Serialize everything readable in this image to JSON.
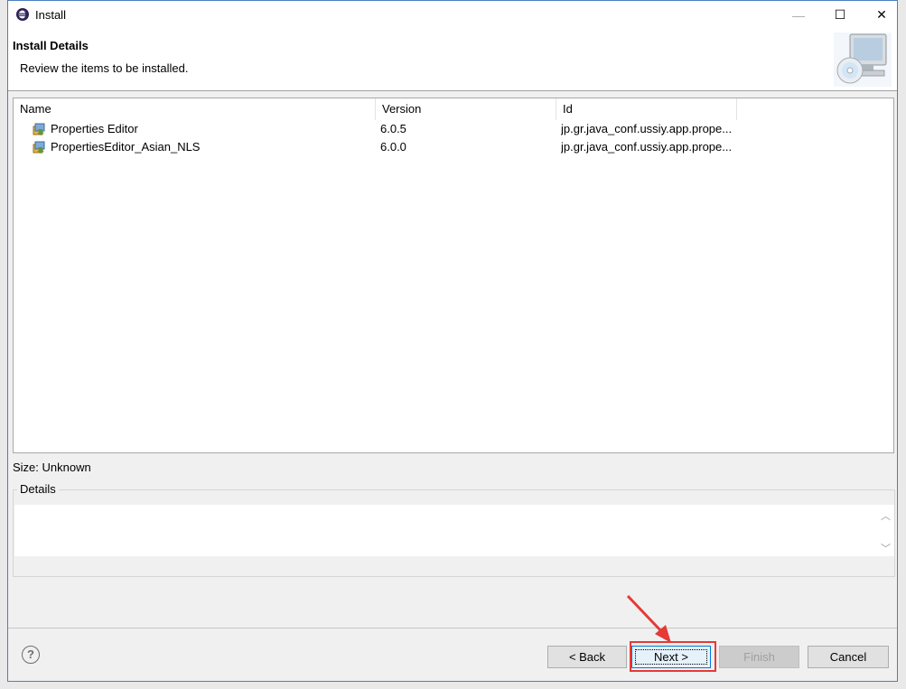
{
  "window": {
    "title": "Install",
    "minimize_glyph": "—",
    "maximize_glyph": "☐",
    "close_glyph": "✕"
  },
  "header": {
    "title": "Install Details",
    "description": "Review the items to be installed."
  },
  "table": {
    "columns": [
      "Name",
      "Version",
      "Id"
    ],
    "rows": [
      {
        "name": "Properties Editor",
        "version": "6.0.5",
        "id": "jp.gr.java_conf.ussiy.app.prope..."
      },
      {
        "name": "PropertiesEditor_Asian_NLS",
        "version": "6.0.0",
        "id": "jp.gr.java_conf.ussiy.app.prope..."
      }
    ]
  },
  "size_label": "Size: Unknown",
  "details": {
    "label": "Details",
    "value": ""
  },
  "footer": {
    "help_glyph": "?",
    "back_label": "< Back",
    "next_label": "Next >",
    "finish_label": "Finish",
    "cancel_label": "Cancel"
  },
  "colors": {
    "accent_border": "#4a7fc1",
    "annotation_red": "#e53a36",
    "next_focus": "#0078d7"
  },
  "icons": {
    "app": "eclipse-icon",
    "package": "feature-package-icon",
    "wizard": "install-computer-cd-icon"
  }
}
